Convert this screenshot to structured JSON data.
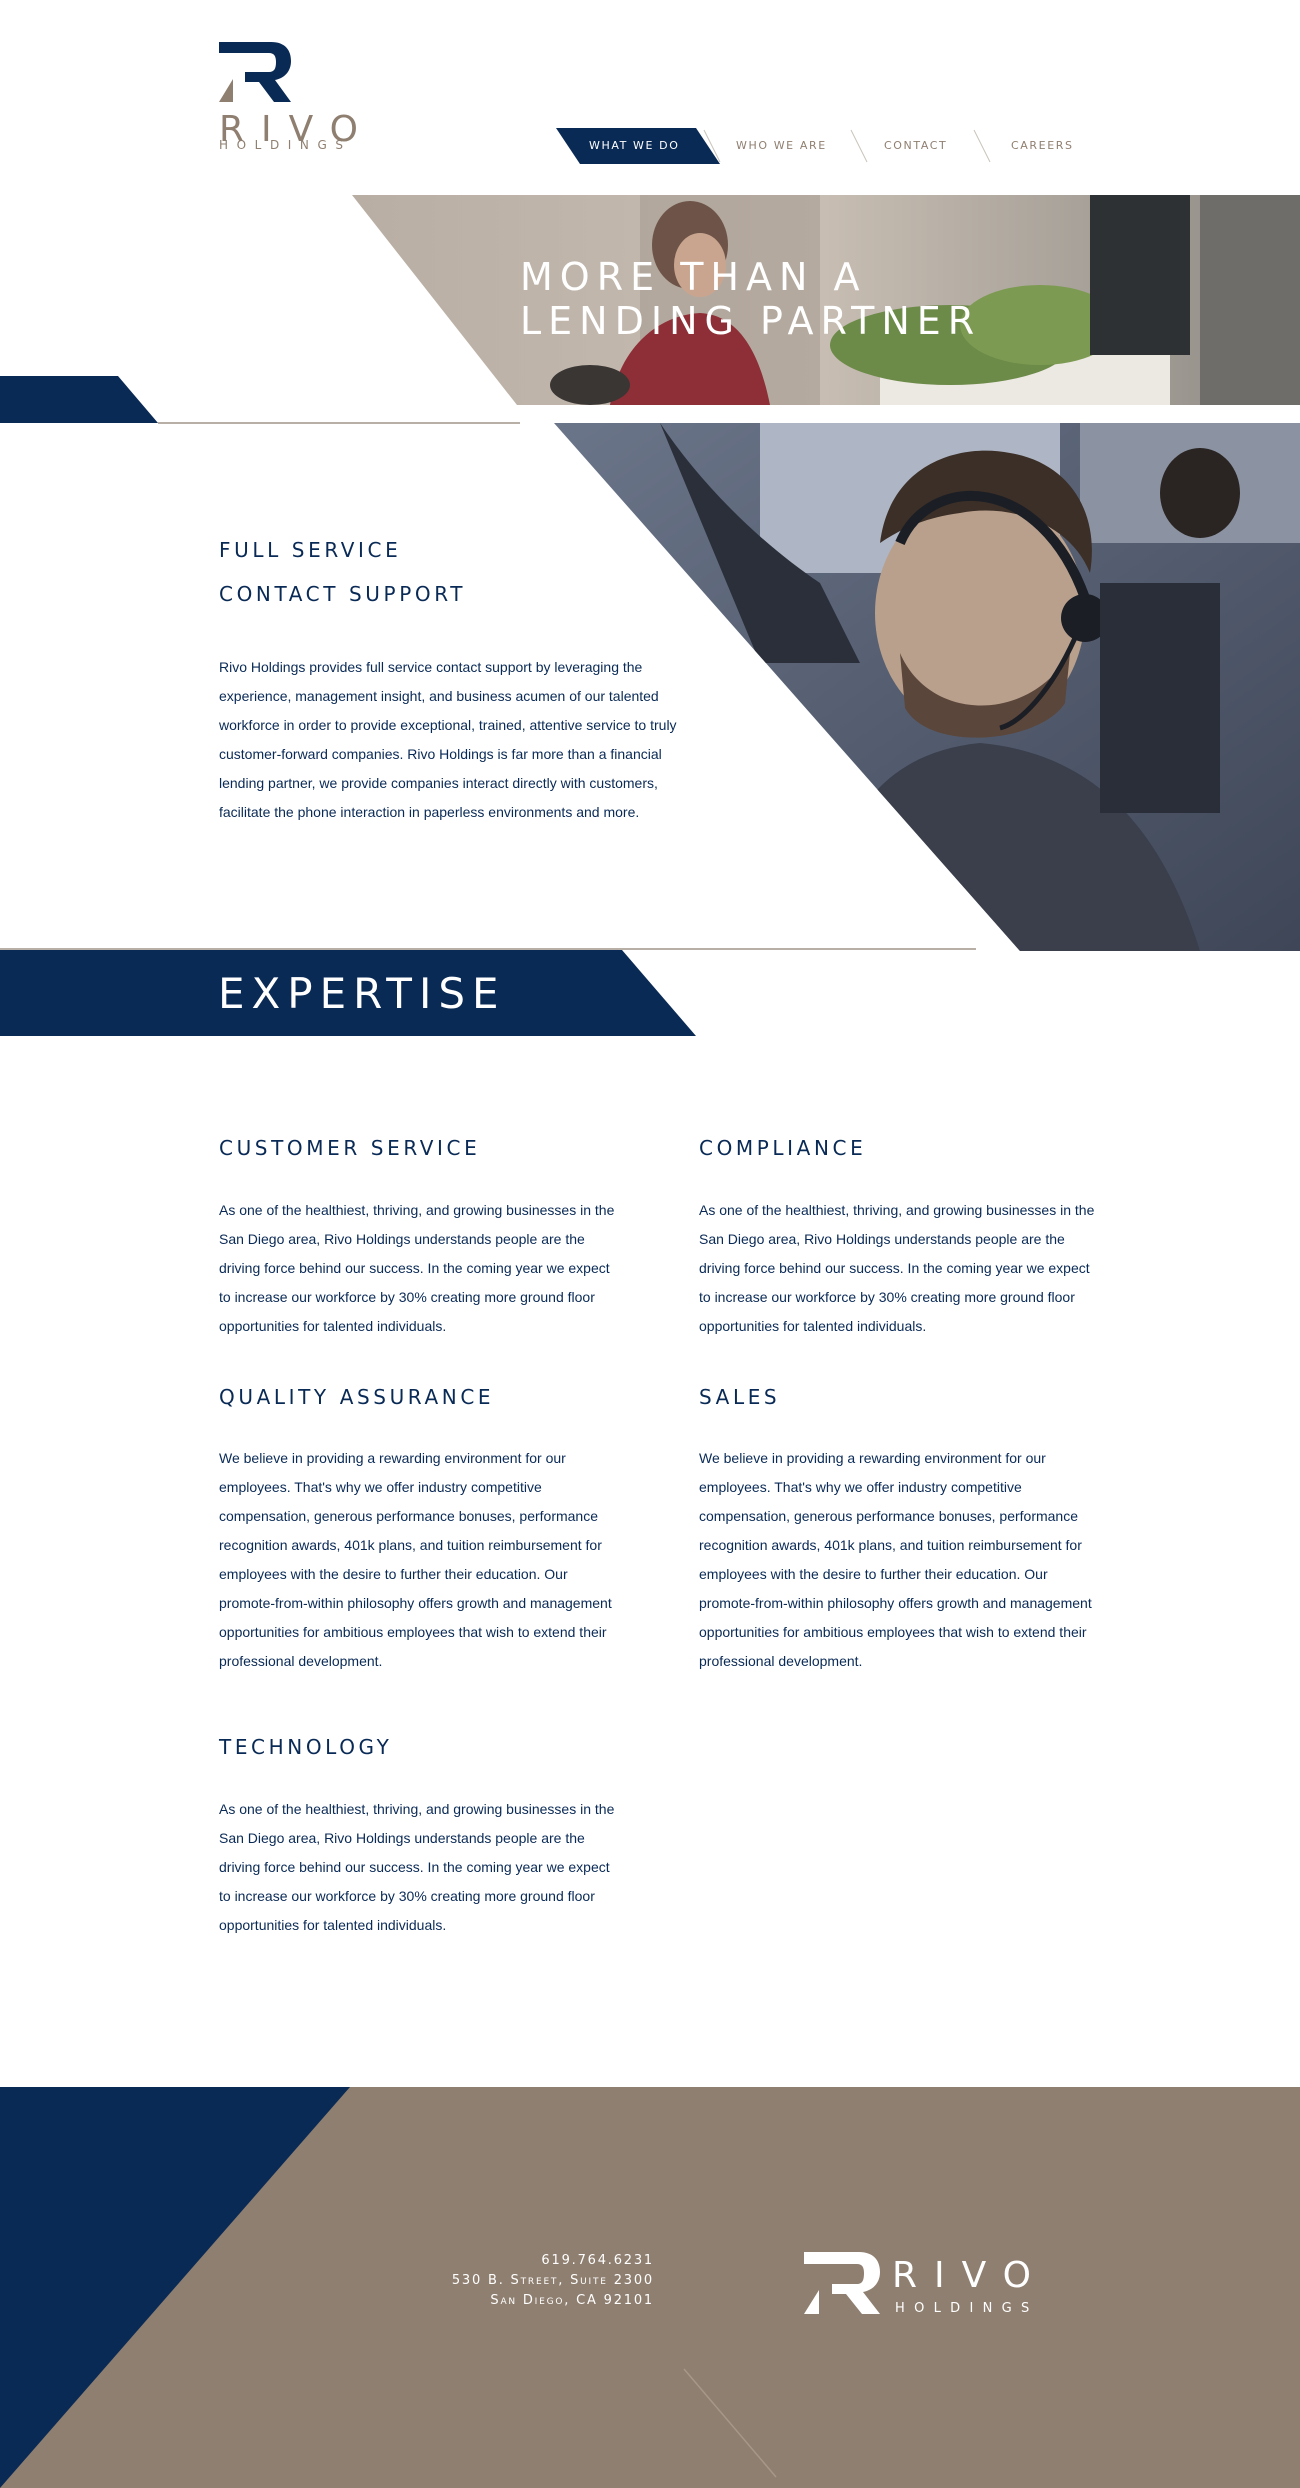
{
  "brand": {
    "name": "RIVO",
    "sub": "HOLDINGS",
    "colors": {
      "navy": "#0a2a56",
      "taupe": "#8f7f70",
      "white": "#ffffff"
    }
  },
  "nav": {
    "items": [
      {
        "label": "WHAT WE DO",
        "active": true
      },
      {
        "label": "WHO WE ARE",
        "active": false
      },
      {
        "label": "CONTACT",
        "active": false
      },
      {
        "label": "CAREERS",
        "active": false
      }
    ]
  },
  "hero": {
    "line1": "MORE THAN A",
    "line2": "LENDING PARTNER"
  },
  "full_service": {
    "heading_line1": "FULL SERVICE",
    "heading_line2": "CONTACT SUPPORT",
    "lines": [
      "Rivo Holdings provides full service contact support by leveraging the",
      "experience, management insight, and business acumen of our talented",
      "workforce in order to provide exceptional, trained, attentive service to truly",
      "customer-forward companies. Rivo Holdings is far more than a financial",
      "lending partner, we provide companies interact directly with customers,",
      "facilitate the phone interaction in paperless environments and more."
    ]
  },
  "expertise": {
    "title": "EXPERTISE",
    "items": [
      {
        "heading": "CUSTOMER SERVICE",
        "lines": [
          "As one of the healthiest, thriving, and growing businesses in the",
          "San Diego area, Rivo Holdings understands people are the",
          "driving force behind our success. In the coming year we expect",
          "to increase our workforce by 30% creating more ground floor",
          "opportunities for talented individuals."
        ]
      },
      {
        "heading": "COMPLIANCE",
        "lines": [
          "As one of the healthiest, thriving, and growing businesses in the",
          "San Diego area, Rivo Holdings understands people are the",
          "driving force behind our success. In the coming year we expect",
          "to increase our workforce by 30% creating more ground floor",
          "opportunities for talented individuals."
        ]
      },
      {
        "heading": "QUALITY ASSURANCE",
        "lines": [
          "We believe in providing a rewarding environment for our",
          "employees.  That's why we offer industry competitive",
          "compensation, generous performance bonuses, performance",
          "recognition awards, 401k plans, and tuition reimbursement for",
          "employees with the desire to further their education.  Our",
          "promote-from-within philosophy offers growth and management",
          "opportunities for ambitious employees that wish to extend their",
          "professional development."
        ]
      },
      {
        "heading": "SALES",
        "lines": [
          "We believe in providing a rewarding environment for our",
          "employees.  That's why we offer industry competitive",
          "compensation, generous performance bonuses, performance",
          "recognition awards, 401k plans, and tuition reimbursement for",
          "employees with the desire to further their education.  Our",
          "promote-from-within philosophy offers growth and management",
          "opportunities for ambitious employees that wish to extend their",
          "professional development."
        ]
      },
      {
        "heading": "TECHNOLOGY",
        "lines": [
          "As one of the healthiest, thriving, and growing businesses in the",
          "San Diego area, Rivo Holdings understands people are the",
          "driving force behind our success. In the coming year we expect",
          "to increase our workforce by 30% creating more ground floor",
          "opportunities for talented individuals."
        ]
      }
    ]
  },
  "footer": {
    "phone": "619.764.6231",
    "address1": "530 B. Street, Suite 2300",
    "address2": "San Diego, CA 92101"
  }
}
